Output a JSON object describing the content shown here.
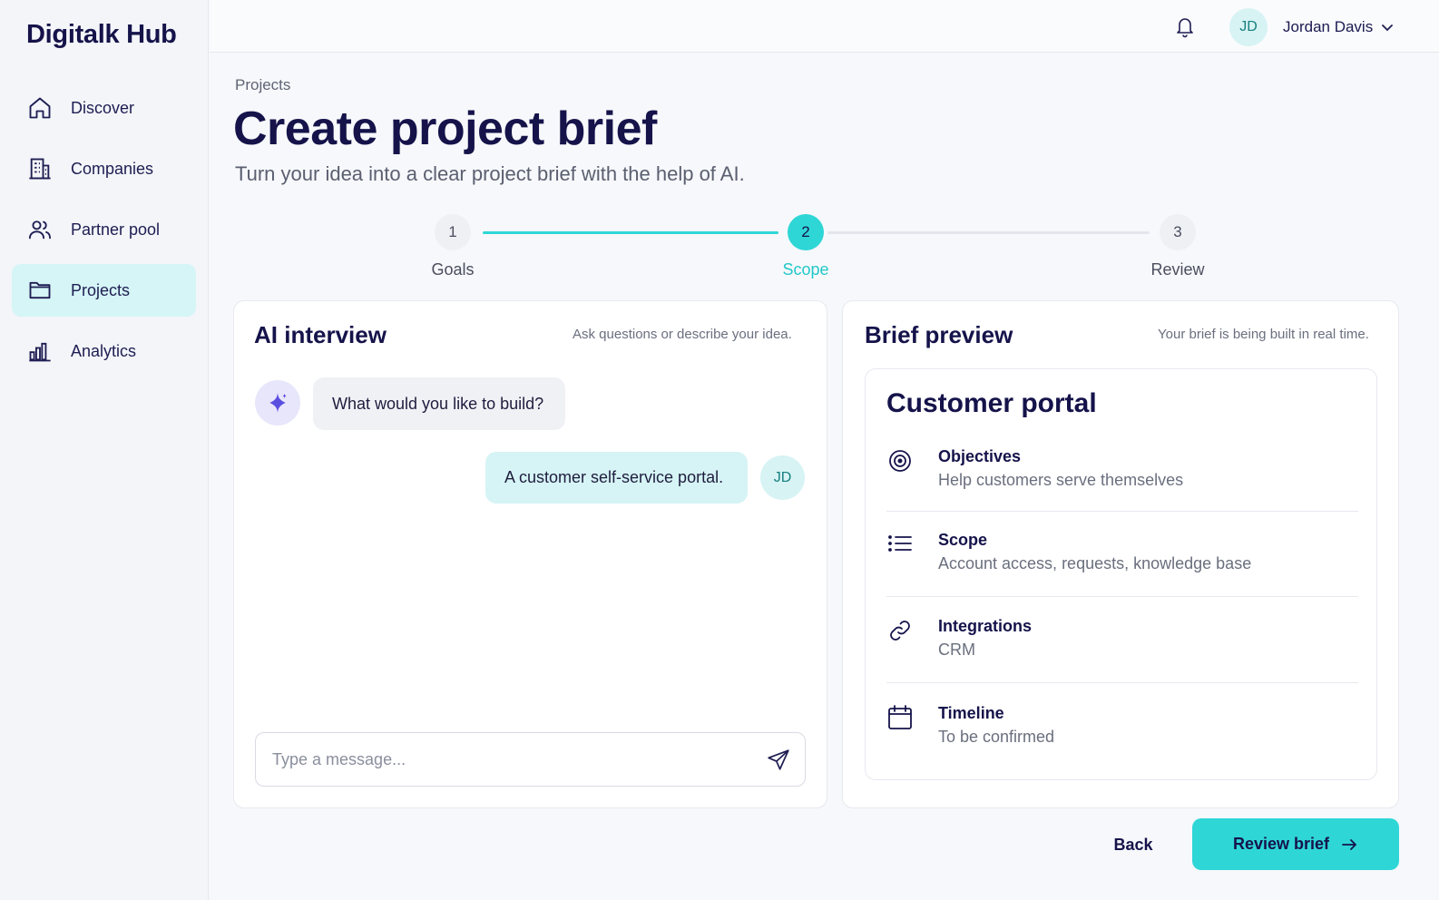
{
  "app": {
    "brand": "Digitalk Hub"
  },
  "sidebar": {
    "items": [
      {
        "label": "Discover",
        "icon": "home-icon",
        "active": false
      },
      {
        "label": "Companies",
        "icon": "building-icon",
        "active": false
      },
      {
        "label": "Partner pool",
        "icon": "users-icon",
        "active": false
      },
      {
        "label": "Projects",
        "icon": "folder-icon",
        "active": true
      },
      {
        "label": "Analytics",
        "icon": "bar-chart-icon",
        "active": false
      }
    ]
  },
  "topbar": {
    "notification_icon": "bell-icon",
    "user_initials": "JD",
    "user_name": "Jordan Davis",
    "dropdown_icon": "chevron-down-icon"
  },
  "page": {
    "breadcrumb": "Projects",
    "title": "Create project brief",
    "subtitle": "Turn your idea into a clear project brief with the help of AI."
  },
  "stepper": {
    "steps": [
      {
        "number": "1",
        "label": "Goals",
        "state": "done"
      },
      {
        "number": "2",
        "label": "Scope",
        "state": "current"
      },
      {
        "number": "3",
        "label": "Review",
        "state": "upcoming"
      }
    ]
  },
  "interview": {
    "title": "AI interview",
    "hint": "Ask questions or describe your idea.",
    "bot_icon": "sparkle-icon",
    "messages": [
      {
        "from": "bot",
        "text": "What would you like to build?"
      },
      {
        "from": "user",
        "text": "A customer self-service portal.",
        "initials": "JD"
      }
    ],
    "input_placeholder": "Type a message...",
    "send_icon": "send-icon"
  },
  "preview": {
    "title": "Brief preview",
    "hint": "Your brief is being built in real time.",
    "brief_title": "Customer portal",
    "rows": [
      {
        "icon": "target-icon",
        "title": "Objectives",
        "value": "Help customers serve themselves"
      },
      {
        "icon": "list-icon",
        "title": "Scope",
        "value": "Account access, requests, knowledge base"
      },
      {
        "icon": "link-icon",
        "title": "Integrations",
        "value": "CRM"
      },
      {
        "icon": "calendar-icon",
        "title": "Timeline",
        "value": "To be confirmed"
      }
    ]
  },
  "footer": {
    "back_label": "Back",
    "primary_label": "Review brief",
    "primary_icon": "arrow-right-icon"
  },
  "colors": {
    "accent": "#2fd6d6",
    "navy": "#15134a",
    "active_nav_bg": "#d5f5f6",
    "bot_avatar_bg": "#e8e6fb",
    "sparkle": "#5b4fe0"
  }
}
